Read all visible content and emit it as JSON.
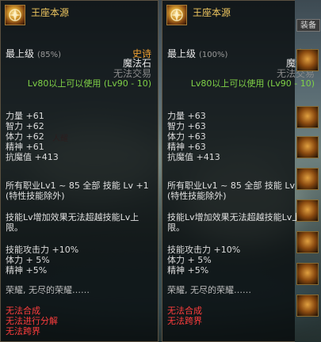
{
  "panels": [
    {
      "title": "王座本源",
      "level_label": "最上级",
      "level_pct": "(85%)",
      "rarity": "史诗",
      "type": "魔法石",
      "trade": "无法交易",
      "requirement": "Lv80以上可以使用 (Lv90 - 10)",
      "stats": [
        {
          "text": "力量 +61"
        },
        {
          "text": "智力 +62"
        },
        {
          "text": "体力 +62"
        },
        {
          "text": "精神 +61"
        },
        {
          "text": "抗魔值 +413"
        }
      ],
      "skill_line1": "所有职业Lv1 ~ 85 全部 技能 Lv +1",
      "skill_line2": "(特性技能除外)",
      "desc_line1": "技能Lv增加效果无法超越技能Lv上",
      "desc_line2": "限。",
      "bonus": [
        {
          "text": "技能攻击力 +10%"
        },
        {
          "text": "体力 + 5%"
        },
        {
          "text": "精神 +5%"
        }
      ],
      "flavor": "荣耀, 无尽的荣耀……",
      "restrictions": [
        {
          "text": "无法合成"
        },
        {
          "text": "无法进行分解"
        },
        {
          "text": "无法跨界"
        }
      ]
    },
    {
      "title": "王座本源",
      "level_label": "最上级",
      "level_pct": "(100%)",
      "rarity": "史诗",
      "type": "魔法石",
      "trade": "无法交易",
      "requirement": "Lv80以上可以使用 (Lv90 - 10)",
      "stats": [
        {
          "text": "力量 +63"
        },
        {
          "text": "智力 +63"
        },
        {
          "text": "体力 +63"
        },
        {
          "text": "精神 +63"
        },
        {
          "text": "抗魔值 +413"
        }
      ],
      "skill_line1": "所有职业Lv1 ~ 85 全部 技能 Lv +1",
      "skill_line2": "(特性技能除外)",
      "desc_line1": "技能Lv增加效果无法超越技能Lv上",
      "desc_line2": "限。",
      "bonus": [
        {
          "text": "技能攻击力 +10%"
        },
        {
          "text": "体力 + 5%"
        },
        {
          "text": "精神 +5%"
        }
      ],
      "flavor": "荣耀, 无尽的荣耀……",
      "restrictions": [
        {
          "text": "无法合成"
        },
        {
          "text": "无法跨界"
        }
      ]
    }
  ],
  "sidebar": {
    "tab_label": "装备"
  },
  "bg_mark": "人耀",
  "colors": {
    "title": "#f0c860",
    "rarity": "#f0a030",
    "requirement": "#7fd147",
    "restriction": "#ff3d3d"
  },
  "icons": {
    "item": "orb-icon"
  }
}
